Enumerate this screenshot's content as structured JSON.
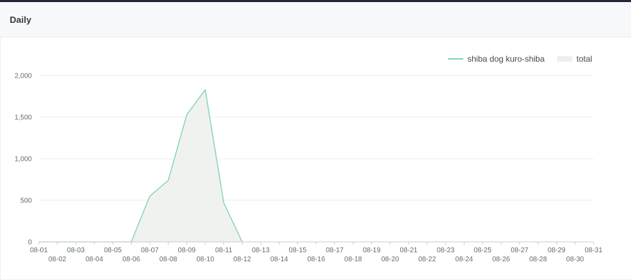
{
  "panel": {
    "title": "Daily"
  },
  "chart_data": {
    "type": "area",
    "x": [
      "08-01",
      "08-02",
      "08-03",
      "08-04",
      "08-05",
      "08-06",
      "08-07",
      "08-08",
      "08-09",
      "08-10",
      "08-11",
      "08-12",
      "08-13",
      "08-14",
      "08-15",
      "08-16",
      "08-17",
      "08-18",
      "08-19",
      "08-20",
      "08-21",
      "08-22",
      "08-23",
      "08-24",
      "08-25",
      "08-26",
      "08-27",
      "08-28",
      "08-29",
      "08-30",
      "08-31"
    ],
    "series": [
      {
        "name": "shiba dog kuro-shiba",
        "style": "line",
        "color": "#7fd3b4",
        "values": [
          0,
          0,
          0,
          0,
          0,
          0,
          550,
          740,
          1530,
          1830,
          470,
          0,
          null,
          null,
          null,
          null,
          null,
          null,
          null,
          null,
          null,
          null,
          null,
          null,
          null,
          null,
          null,
          null,
          null,
          null,
          null
        ]
      },
      {
        "name": "total",
        "style": "area",
        "color": "#f0f2ef",
        "stroke": "#a8d8bf",
        "values": [
          0,
          0,
          0,
          0,
          0,
          0,
          550,
          740,
          1530,
          1830,
          470,
          0,
          null,
          null,
          null,
          null,
          null,
          null,
          null,
          null,
          null,
          null,
          null,
          null,
          null,
          null,
          null,
          null,
          null,
          null,
          null
        ]
      }
    ],
    "y_ticks": [
      "0",
      "500",
      "1,000",
      "1,500",
      "2,000"
    ],
    "ylim": [
      0,
      2000
    ],
    "grid": true,
    "legend": "top-right"
  }
}
